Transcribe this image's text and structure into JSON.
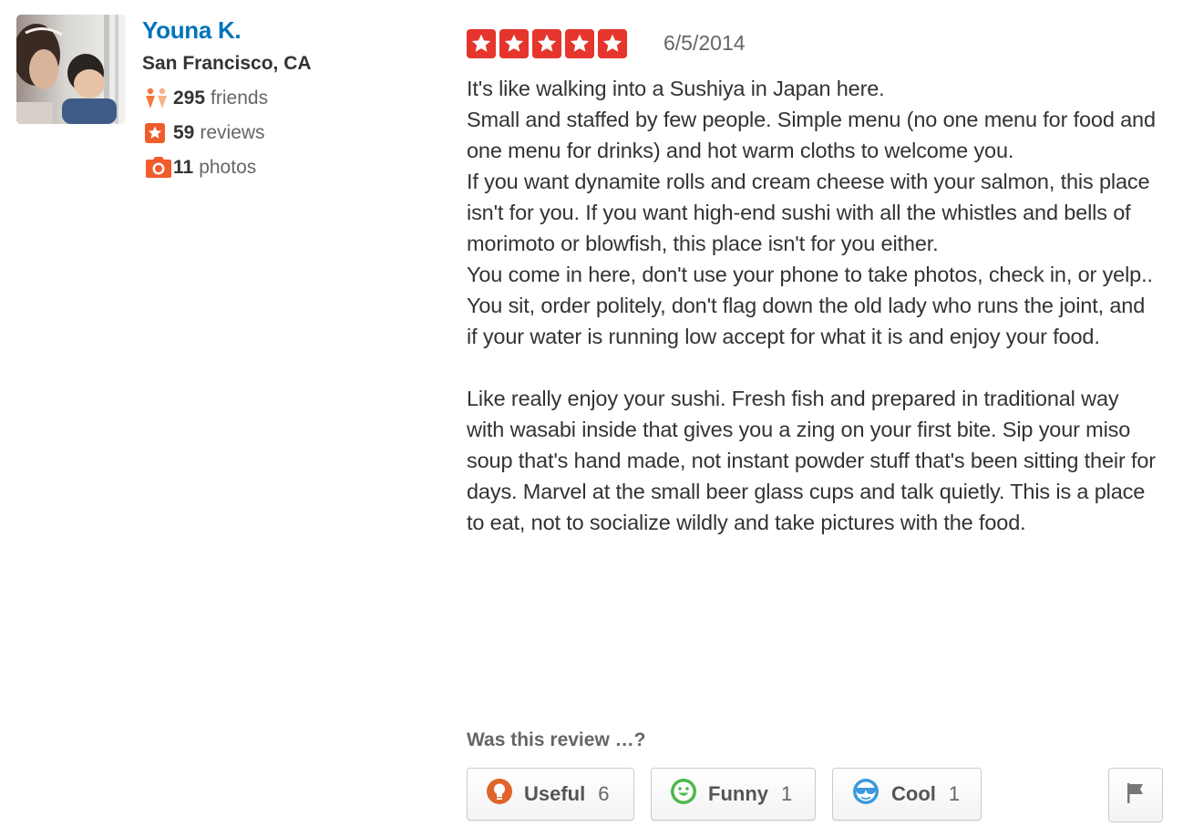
{
  "user": {
    "name": "Youna K.",
    "location": "San Francisco, CA",
    "friends_count": "295",
    "friends_label": "friends",
    "reviews_count": "59",
    "reviews_label": "reviews",
    "photos_count": "11",
    "photos_label": "photos"
  },
  "review": {
    "rating": 5,
    "rating_max": 5,
    "date": "6/5/2014",
    "lines": [
      "It's like walking into a Sushiya in Japan here.",
      "Small and staffed by few people. Simple menu (no one menu for food and one menu for drinks) and hot warm cloths to welcome you.",
      "If you want dynamite rolls and cream cheese with your salmon, this place isn't for you. If you want high-end sushi with all the whistles and bells of morimoto or blowfish, this place isn't for you either.",
      "You come in here, don't use your phone to take photos, check in, or yelp.. You sit, order politely, don't flag down the old lady who runs the joint, and if your water is running low accept for what it is and enjoy your food.",
      "",
      "Like really enjoy your sushi. Fresh fish and prepared in traditional way with wasabi inside that gives you a zing on your first bite. Sip your miso soup that's hand made, not instant powder stuff that's been sitting their for days. Marvel at the small beer glass cups and talk quietly. This is a place to eat, not to socialize wildly and take pictures with the food."
    ]
  },
  "votes": {
    "question": "Was this review …?",
    "useful": {
      "label": "Useful",
      "count": "6"
    },
    "funny": {
      "label": "Funny",
      "count": "1"
    },
    "cool": {
      "label": "Cool",
      "count": "1"
    }
  },
  "icons": {
    "star": "star-icon",
    "friends": "friends-icon",
    "reviews": "review-star-icon",
    "photos": "camera-icon",
    "useful": "lightbulb-icon",
    "funny": "smiley-icon",
    "cool": "sunglasses-icon",
    "flag": "flag-icon"
  },
  "colors": {
    "link_blue": "#0073bb",
    "star_red": "#e5352c",
    "useful_orange": "#e0642a",
    "funny_green": "#4cb84c",
    "cool_blue": "#3b99de",
    "friends_orange": "#f0793c"
  }
}
